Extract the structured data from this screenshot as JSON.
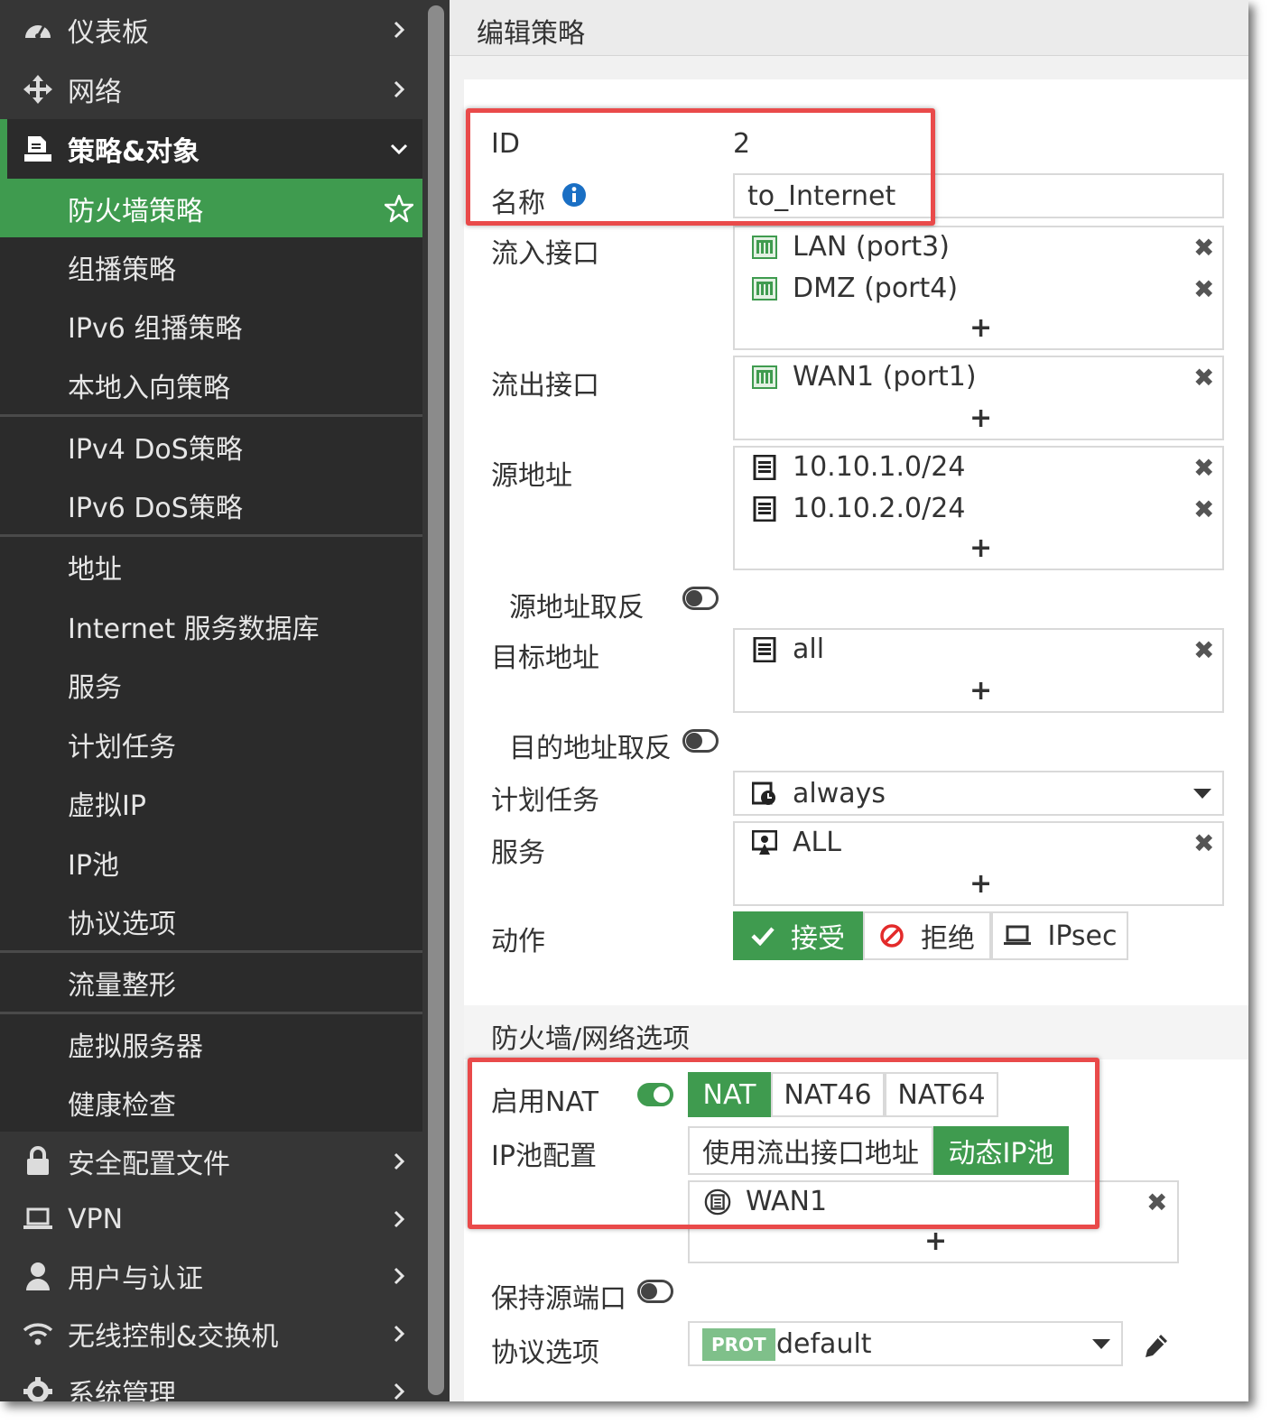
{
  "sidebar": {
    "items": [
      {
        "label": "仪表板",
        "icon": "dashboard-icon"
      },
      {
        "label": "网络",
        "icon": "network-move-icon"
      },
      {
        "label": "策略&对象",
        "icon": "policy-document-icon"
      },
      {
        "label": "防火墙策略",
        "icon": "star-icon"
      },
      {
        "label": "组播策略"
      },
      {
        "label": "IPv6 组播策略"
      },
      {
        "label": "本地入向策略"
      },
      {
        "label": "IPv4 DoS策略"
      },
      {
        "label": "IPv6 DoS策略"
      },
      {
        "label": "地址"
      },
      {
        "label": "Internet 服务数据库"
      },
      {
        "label": "服务"
      },
      {
        "label": "计划任务"
      },
      {
        "label": "虚拟IP"
      },
      {
        "label": "IP池"
      },
      {
        "label": "协议选项"
      },
      {
        "label": "流量整形"
      },
      {
        "label": "虚拟服务器"
      },
      {
        "label": "健康检查"
      },
      {
        "label": "安全配置文件",
        "icon": "lock-icon"
      },
      {
        "label": "VPN",
        "icon": "laptop-icon"
      },
      {
        "label": "用户与认证",
        "icon": "user-icon"
      },
      {
        "label": "无线控制&交换机",
        "icon": "wifi-icon"
      },
      {
        "label": "系统管理",
        "icon": "gear-icon"
      }
    ]
  },
  "page": {
    "title": "编辑策略"
  },
  "form": {
    "id_label": "ID",
    "id_value": "2",
    "name_label": "名称",
    "name_value": "to_Internet",
    "incoming_label": "流入接口",
    "incoming": [
      "LAN (port3)",
      "DMZ (port4)"
    ],
    "outgoing_label": "流出接口",
    "outgoing": [
      "WAN1 (port1)"
    ],
    "source_label": "源地址",
    "source": [
      "10.10.1.0/24",
      "10.10.2.0/24"
    ],
    "negate_source_label": "源地址取反",
    "negate_source": false,
    "destination_label": "目标地址",
    "destination": [
      "all"
    ],
    "negate_destination_label": "目的地址取反",
    "negate_destination": false,
    "schedule_label": "计划任务",
    "schedule_value": "always",
    "service_label": "服务",
    "service": [
      "ALL"
    ],
    "action_label": "动作",
    "actions": [
      "接受",
      "拒绝",
      "IPsec"
    ],
    "action_selected": "接受",
    "add_symbol": "+",
    "remove_symbol": "✖"
  },
  "firewall_options": {
    "section_title": "防火墙/网络选项",
    "nat_label": "启用NAT",
    "nat_enabled": true,
    "nat_modes": [
      "NAT",
      "NAT46",
      "NAT64"
    ],
    "nat_mode_selected": "NAT",
    "ippool_label": "IP池配置",
    "ippool_modes": [
      "使用流出接口地址",
      "动态IP池"
    ],
    "ippool_mode_selected": "动态IP池",
    "ippool": [
      "WAN1"
    ],
    "preserve_port_label": "保持源端口",
    "preserve_port": false,
    "protocol_label": "协议选项",
    "protocol_badge": "PROT",
    "protocol_value": "default"
  },
  "colors": {
    "accent": "#3f9b4f",
    "sidebar_bg": "#363636",
    "highlight": "#e94a4a"
  }
}
